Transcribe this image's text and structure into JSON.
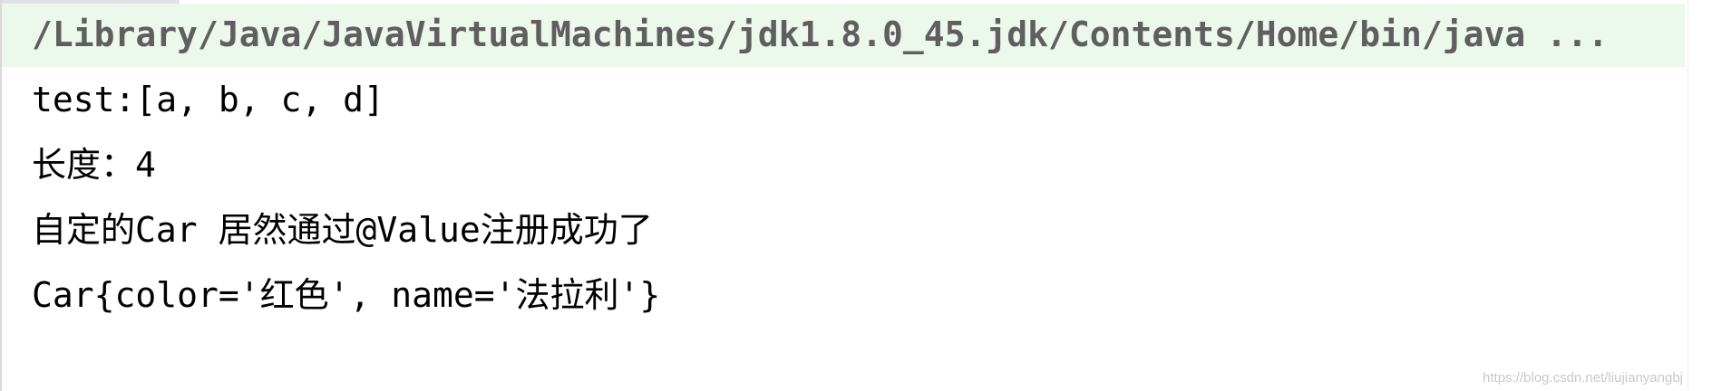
{
  "console": {
    "command_line": "/Library/Java/JavaVirtualMachines/jdk1.8.0_45.jdk/Contents/Home/bin/java ...",
    "output_lines": [
      "test:[a, b, c, d]",
      "长度：4",
      "自定的Car 居然通过@Value注册成功了",
      "Car{color='红色', name='法拉利'}"
    ]
  },
  "watermark": "https://blog.csdn.net/liujianyangbj",
  "colors": {
    "command_row_background": "#edf8ed",
    "command_text": "#5f5f5f",
    "output_text": "#000000"
  }
}
